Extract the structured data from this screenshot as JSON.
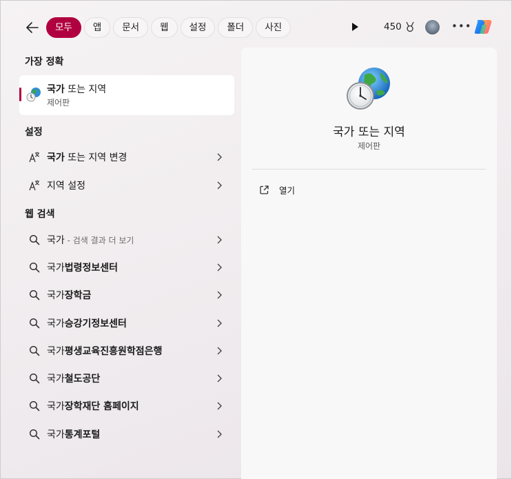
{
  "filters": {
    "back_label": "←",
    "items": [
      "모두",
      "앱",
      "문서",
      "웹",
      "설정",
      "폴더",
      "사진"
    ],
    "active": "모두"
  },
  "header": {
    "points": "450"
  },
  "best_match": {
    "section": "가장 정확",
    "title_bold": "국가",
    "title_rest": " 또는 지역",
    "subtitle": "제어판"
  },
  "settings": {
    "section": "설정",
    "items": [
      {
        "bold": "국가",
        "rest": " 또는 지역 변경"
      },
      {
        "bold": "",
        "rest": "지역 설정"
      }
    ]
  },
  "web": {
    "section": "웹 검색",
    "first": {
      "query": "국가",
      "suffix": " - 검색 결과 더 보기"
    },
    "items": [
      {
        "prefix": "국가",
        "bold": "법령정보센터"
      },
      {
        "prefix": "국가",
        "bold": "장학금"
      },
      {
        "prefix": "국가",
        "bold": "승강기정보센터"
      },
      {
        "prefix": "국가",
        "bold": "평생교육진흥원학점은행"
      },
      {
        "prefix": "국가",
        "bold": "철도공단"
      },
      {
        "prefix": "국가",
        "bold": "장학재단 홈페이지"
      },
      {
        "prefix": "국가",
        "bold": "통계포털"
      }
    ]
  },
  "detail": {
    "title": "국가 또는 지역",
    "subtitle": "제어판",
    "action_open": "열기"
  },
  "colors": {
    "accent": "#b0003f"
  }
}
